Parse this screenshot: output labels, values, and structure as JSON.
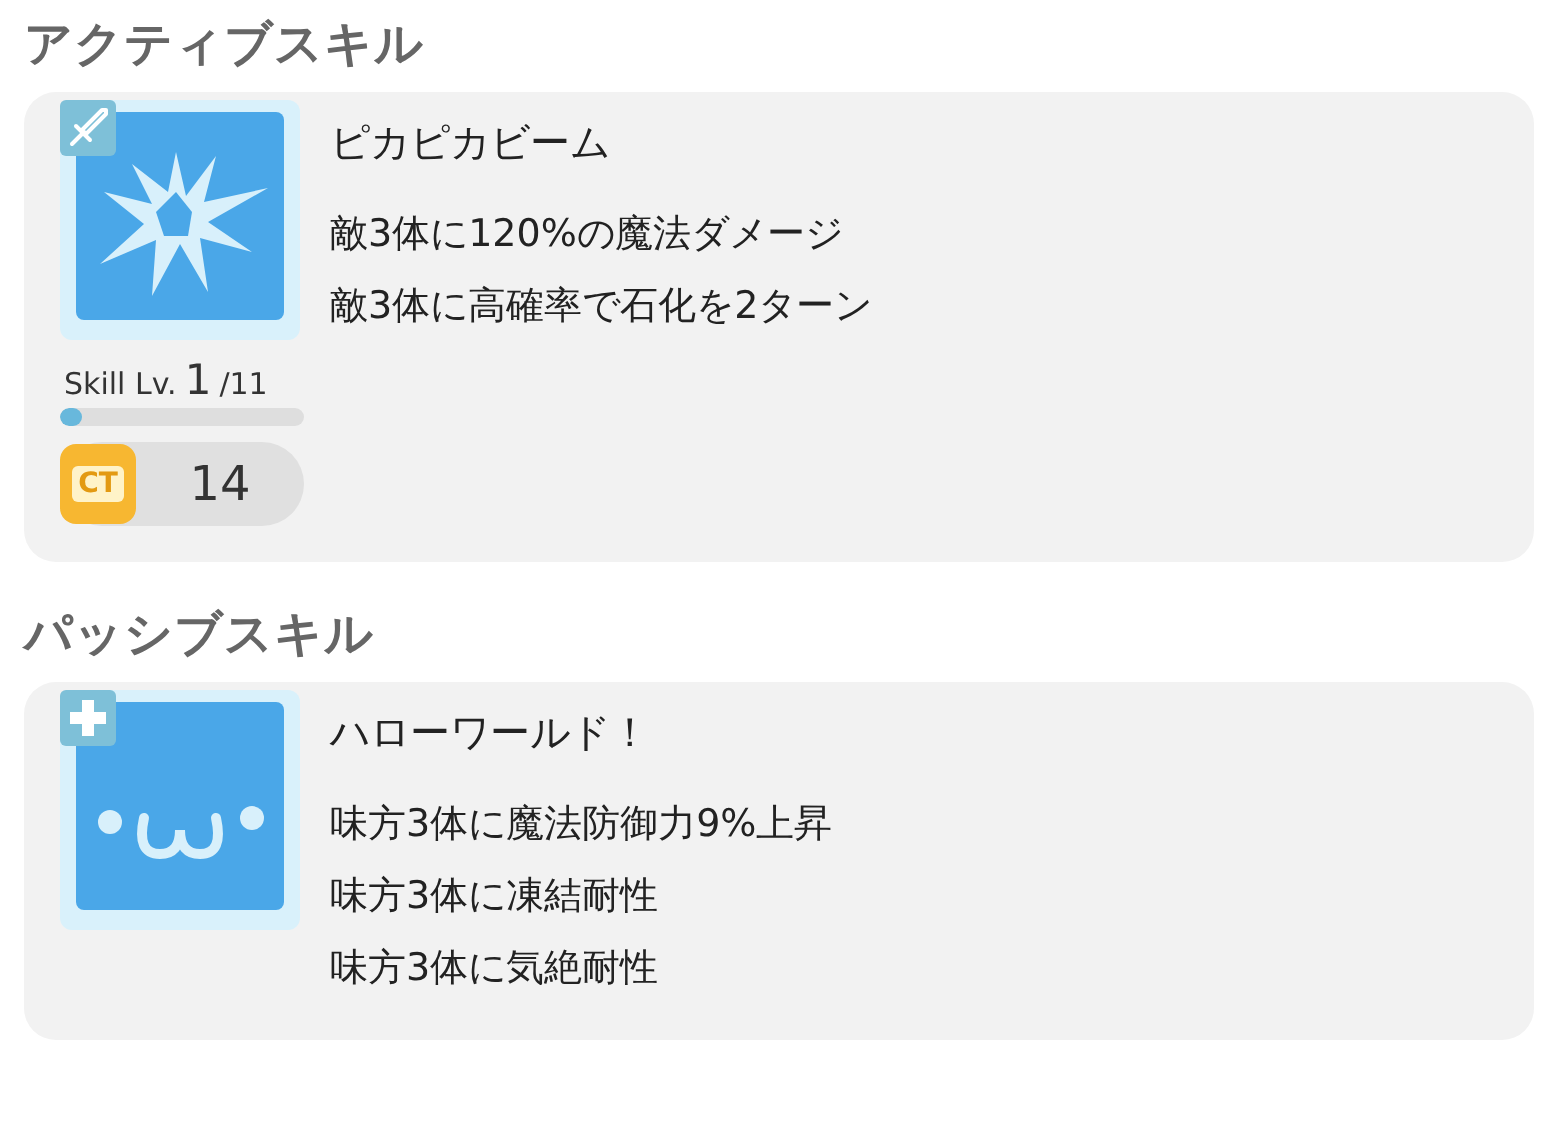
{
  "sections": [
    {
      "heading": "アクティブスキル",
      "skill": {
        "name": "ピカピカビーム",
        "badge": {
          "kind": "sword"
        },
        "art": {
          "kind": "burst"
        },
        "effects": [
          "敵3体に120%の魔法ダメージ",
          "敵3体に高確率で石化を2ターン"
        ],
        "skill_level": {
          "label": "Skill Lv.",
          "current": "1",
          "max": "/11",
          "level": 0.09
        },
        "cooldown": {
          "label": "CT",
          "value": "14"
        }
      }
    },
    {
      "heading": "パッシブスキル",
      "skill": {
        "name": "ハローワールド！",
        "badge": {
          "kind": "plus"
        },
        "art": {
          "kind": "face"
        },
        "effects": [
          "味方3体に魔法防御力9%上昇",
          "味方3体に凍結耐性",
          "味方3体に気絶耐性"
        ]
      }
    }
  ]
}
